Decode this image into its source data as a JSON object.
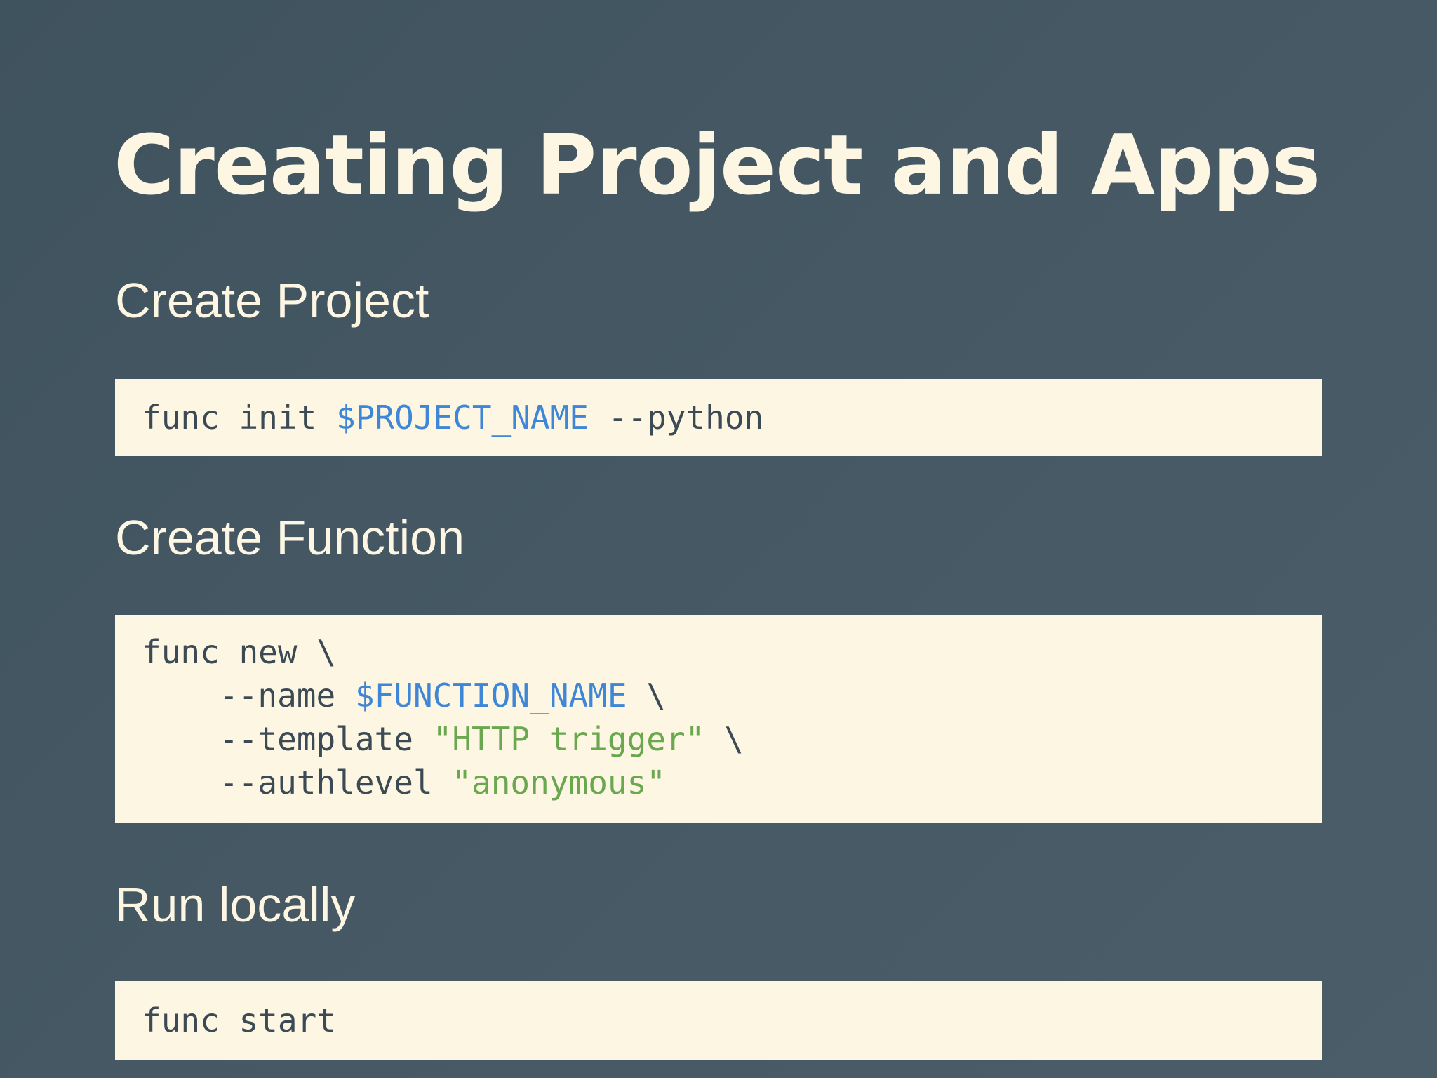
{
  "slide": {
    "title": "Creating Project and Apps"
  },
  "sections": {
    "create_project": {
      "heading": "Create Project",
      "code": {
        "cmd": "func init ",
        "var": "$PROJECT_NAME",
        "rest": " --python"
      }
    },
    "create_function": {
      "heading": "Create Function",
      "code": {
        "line1": "func new \\",
        "line2_opt": "--name ",
        "line2_var": "$FUNCTION_NAME",
        "line2_end": " \\",
        "line3_opt": "--template ",
        "line3_str": "\"HTTP trigger\"",
        "line3_end": " \\",
        "line4_opt": "--authlevel ",
        "line4_str": "\"anonymous\""
      }
    },
    "run_locally": {
      "heading": "Run locally",
      "code": {
        "cmd": "func start"
      }
    }
  },
  "colors": {
    "background": "#455864",
    "text_light": "#fdf6e3",
    "code_background": "#fdf6e3",
    "code_text": "#3b4a54",
    "variable": "#3f86d6",
    "string": "#6aa84f"
  }
}
